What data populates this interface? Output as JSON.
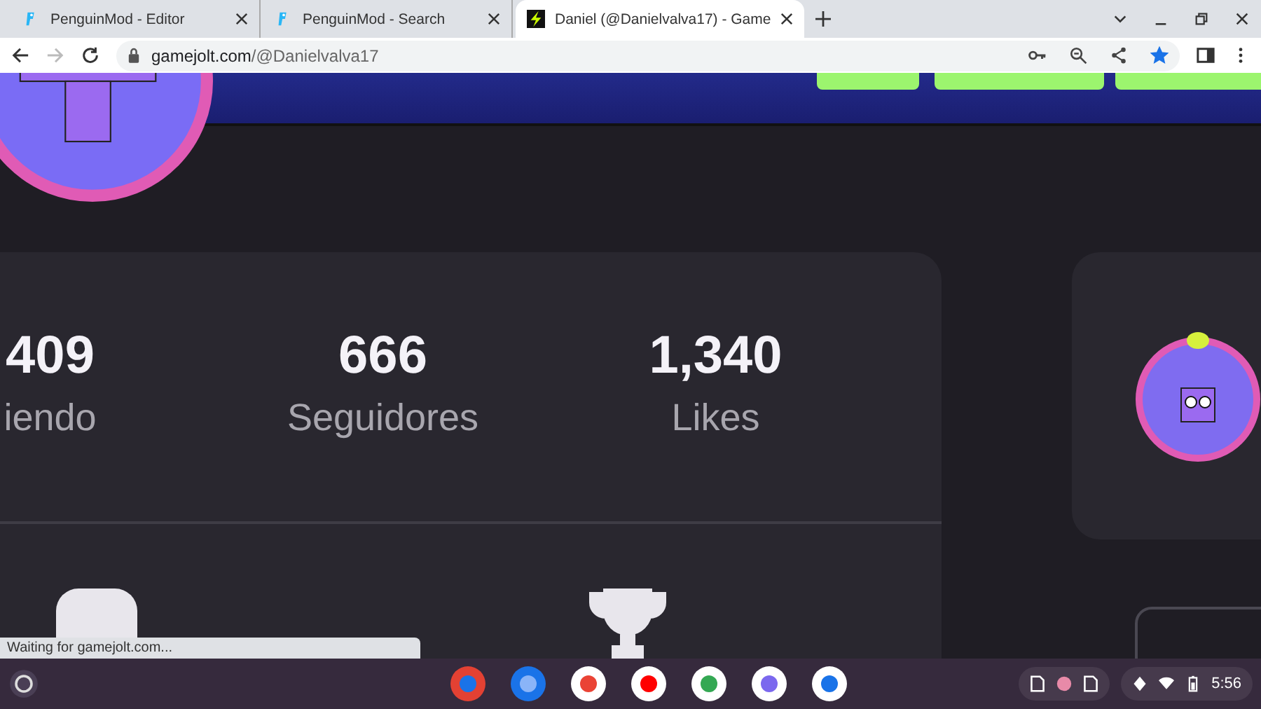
{
  "tabs": [
    {
      "title": "PenguinMod - Editor",
      "kind": "penguin",
      "selected": false
    },
    {
      "title": "PenguinMod - Search",
      "kind": "penguin",
      "selected": false
    },
    {
      "title": "Daniel (@Danielvalva17) - Game",
      "kind": "lightning",
      "selected": true
    }
  ],
  "address": {
    "host": "gamejolt.com",
    "path": "/@Danielvalva17",
    "starred": true
  },
  "stats": [
    {
      "value": "409",
      "label": "iendo"
    },
    {
      "value": "666",
      "label": "Seguidores"
    },
    {
      "value": "1,340",
      "label": "Likes"
    }
  ],
  "status_text": "Waiting for gamejolt.com...",
  "taskbar": {
    "clock": "5:56"
  }
}
